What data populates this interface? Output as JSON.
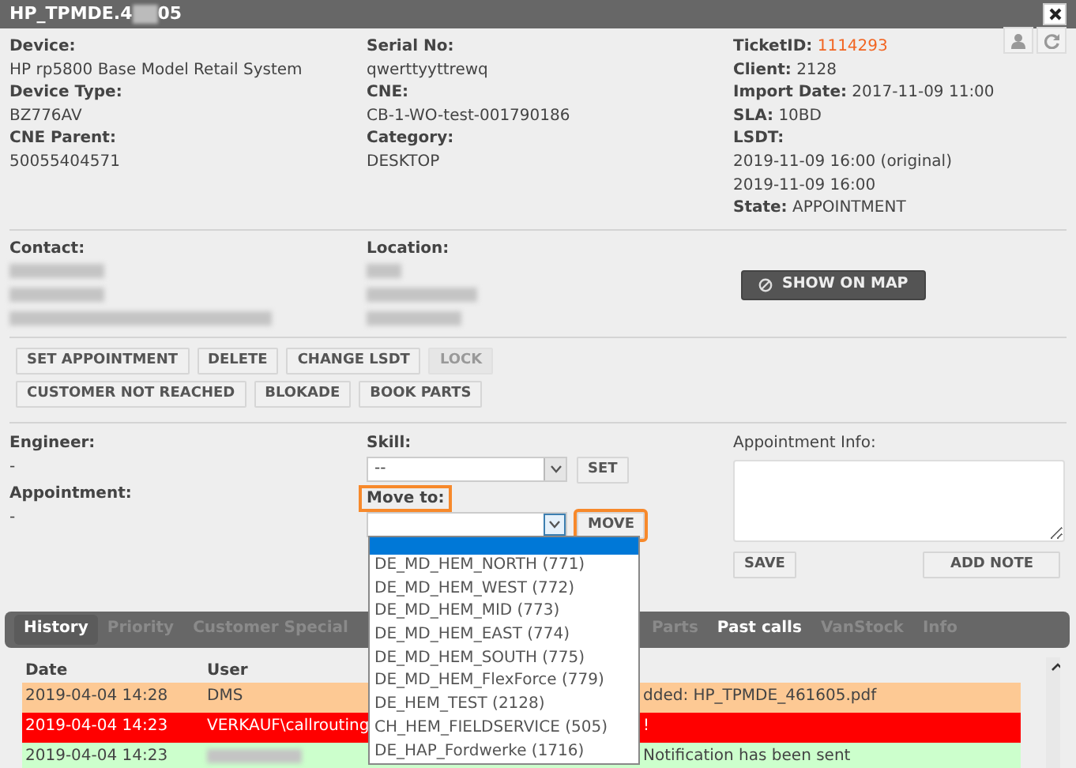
{
  "window": {
    "title": [
      {
        "kind": "text",
        "text": "HP_TPMDE.4"
      },
      {
        "kind": "blurred"
      },
      {
        "kind": "text",
        "text": "05"
      }
    ]
  },
  "device_info": {
    "columns": [
      [
        {
          "kind": "stacked",
          "label": "Device:",
          "values": [
            "HP rp5800 Base Model Retail System"
          ]
        },
        {
          "kind": "stacked",
          "label": "Device Type:",
          "values": [
            "BZ776AV"
          ]
        },
        {
          "kind": "stacked",
          "label": "CNE Parent:",
          "values": [
            "50055404571"
          ]
        }
      ],
      [
        {
          "kind": "stacked",
          "label": "Serial No:",
          "values": [
            "qwerttyyttrewq"
          ]
        },
        {
          "kind": "stacked",
          "label": "CNE:",
          "values": [
            "CB-1-WO-test-001790186"
          ]
        },
        {
          "kind": "stacked",
          "label": "Category:",
          "values": [
            "DESKTOP"
          ]
        }
      ],
      [
        {
          "kind": "inline",
          "label": "TicketID:",
          "values": [
            "1114293"
          ],
          "color": "#f26522"
        },
        {
          "kind": "inline",
          "label": "Client:",
          "values": [
            "2128"
          ]
        },
        {
          "kind": "inline",
          "label": "Import Date:",
          "values": [
            "2017-11-09 11:00"
          ]
        },
        {
          "kind": "inline",
          "label": "SLA:",
          "values": [
            "10BD"
          ]
        },
        {
          "kind": "stacked",
          "label": "LSDT:",
          "values": [
            "2019-11-09 16:00 (original)",
            "2019-11-09 16:00"
          ]
        },
        {
          "kind": "inline",
          "label": "State:",
          "values": [
            "APPOINTMENT"
          ]
        }
      ]
    ]
  },
  "contact": {
    "label": "Contact:",
    "lines": [
      {
        "kind": "blurred"
      },
      {
        "kind": "blurred"
      },
      {
        "kind": "blurred"
      }
    ]
  },
  "location": {
    "label": "Location:",
    "lines": [
      {
        "kind": "blurred"
      },
      {
        "kind": "blurred"
      },
      {
        "kind": "blurred"
      }
    ]
  },
  "show_on_map": {
    "label": "SHOW ON MAP"
  },
  "actions": [
    [
      {
        "label": "SET APPOINTMENT",
        "disabled": false
      },
      {
        "label": "DELETE",
        "disabled": false
      },
      {
        "label": "CHANGE LSDT",
        "disabled": false
      },
      {
        "label": "LOCK",
        "disabled": true
      }
    ],
    [
      {
        "label": "CUSTOMER NOT REACHED",
        "disabled": false
      },
      {
        "label": "BLOKADE",
        "disabled": false
      },
      {
        "label": "BOOK PARTS",
        "disabled": false
      }
    ]
  ],
  "engineer": {
    "label": "Engineer:",
    "value": "-"
  },
  "appointment": {
    "label": "Appointment:",
    "value": "-"
  },
  "skill": {
    "label": "Skill:",
    "value": "--",
    "button": "SET"
  },
  "move_to": {
    "label": "Move to:",
    "highlighted": true,
    "expanded": true,
    "blank_selected": true,
    "button": "MOVE",
    "button_highlighted": true,
    "options": [
      {
        "text": "DE_MD_HEM_NORTH (771)"
      },
      {
        "text": "DE_MD_HEM_WEST (772)"
      },
      {
        "text": "DE_MD_HEM_MID (773)"
      },
      {
        "text": "DE_MD_HEM_EAST (774)"
      },
      {
        "text": "DE_MD_HEM_SOUTH (775)"
      },
      {
        "text": "DE_MD_HEM_FlexForce (779)"
      },
      {
        "text": "DE_HEM_TEST (2128)"
      },
      {
        "text": "CH_HEM_FIELDSERVICE (505)"
      },
      {
        "text": "DE_HAP_Fordwerke (1716)"
      }
    ]
  },
  "appointment_info": {
    "label": "Appointment Info:",
    "save": "SAVE",
    "add_note": "ADD NOTE"
  },
  "tabs": [
    {
      "label": "History",
      "selected": true,
      "disabled": false
    },
    {
      "label": "Priority",
      "selected": false,
      "disabled": true
    },
    {
      "label": "Customer Special",
      "selected": false,
      "disabled": true
    },
    {
      "label": "Parts",
      "selected": false,
      "disabled": true
    },
    {
      "label": "Past calls",
      "selected": false,
      "disabled": false
    },
    {
      "label": "VanStock",
      "selected": false,
      "disabled": true
    },
    {
      "label": "Info",
      "selected": false,
      "disabled": true
    }
  ],
  "history": {
    "columns": [
      "Date",
      "User"
    ],
    "rows": [
      {
        "color": "#fdc994",
        "date": "2019-04-04 14:28",
        "user": {
          "kind": "text",
          "text": "DMS"
        },
        "message": "dded: HP_TPMDE_461605.pdf"
      },
      {
        "color": "#ff0000",
        "date": "2019-04-04 14:23",
        "user": {
          "kind": "text",
          "text": "VERKAUF\\callrouting"
        },
        "message": "!"
      },
      {
        "color": "#ccffcc",
        "date": "2019-04-04 14:23",
        "user": {
          "kind": "blurred"
        },
        "message": "Notification has been sent"
      }
    ]
  }
}
